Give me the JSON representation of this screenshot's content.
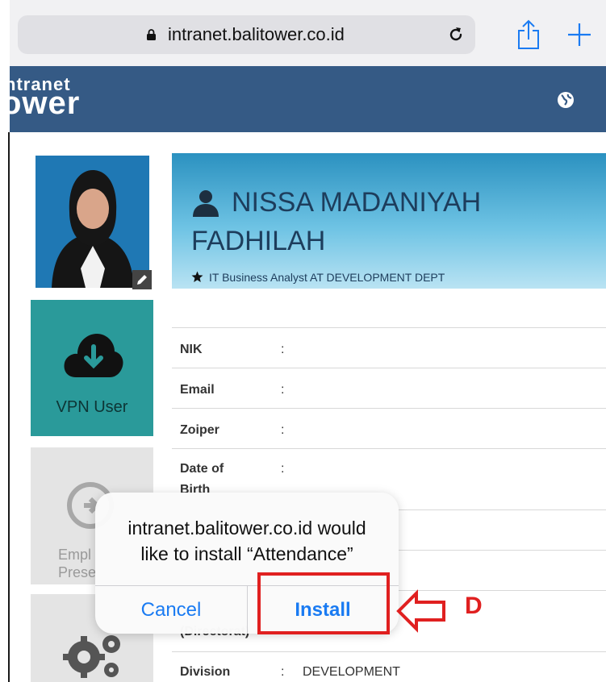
{
  "browser": {
    "url": "intranet.balitower.co.id",
    "icons": [
      "lock-icon",
      "reload-icon",
      "share-icon",
      "new-tab-plus-icon"
    ]
  },
  "header": {
    "logo_top": "ntranet",
    "logo_bottom": "ower",
    "icons": [
      "globe-icon"
    ]
  },
  "profile": {
    "name_line1": "NISSA MADANIYAH",
    "name_line2": "FADHILAH",
    "role": "IT Business Analyst AT DEVELOPMENT DEPT",
    "fields": [
      {
        "label": "NIK",
        "value": ""
      },
      {
        "label": "Email",
        "value": ""
      },
      {
        "label": "Zoiper",
        "value": ""
      },
      {
        "label": "Date of",
        "label2": "Birth",
        "value": ""
      },
      {
        "label": "(Directorat)",
        "value": ""
      },
      {
        "label": "Division",
        "value": "DEVELOPMENT"
      }
    ],
    "colon": ":"
  },
  "tiles": {
    "vpn_label": "VPN User",
    "emp_label_line1": "Empl",
    "emp_label_line2": "Prese"
  },
  "alert": {
    "message_line1": "intranet.balitower.co.id would",
    "message_line2": "like to install “Attendance”",
    "cancel_label": "Cancel",
    "install_label": "Install"
  },
  "annotation": {
    "label": "D",
    "color": "#e02020"
  },
  "colors": {
    "header_bg": "#355a85",
    "vpn_tile": "#2a9a9a",
    "ios_blue": "#1a7bf2"
  }
}
